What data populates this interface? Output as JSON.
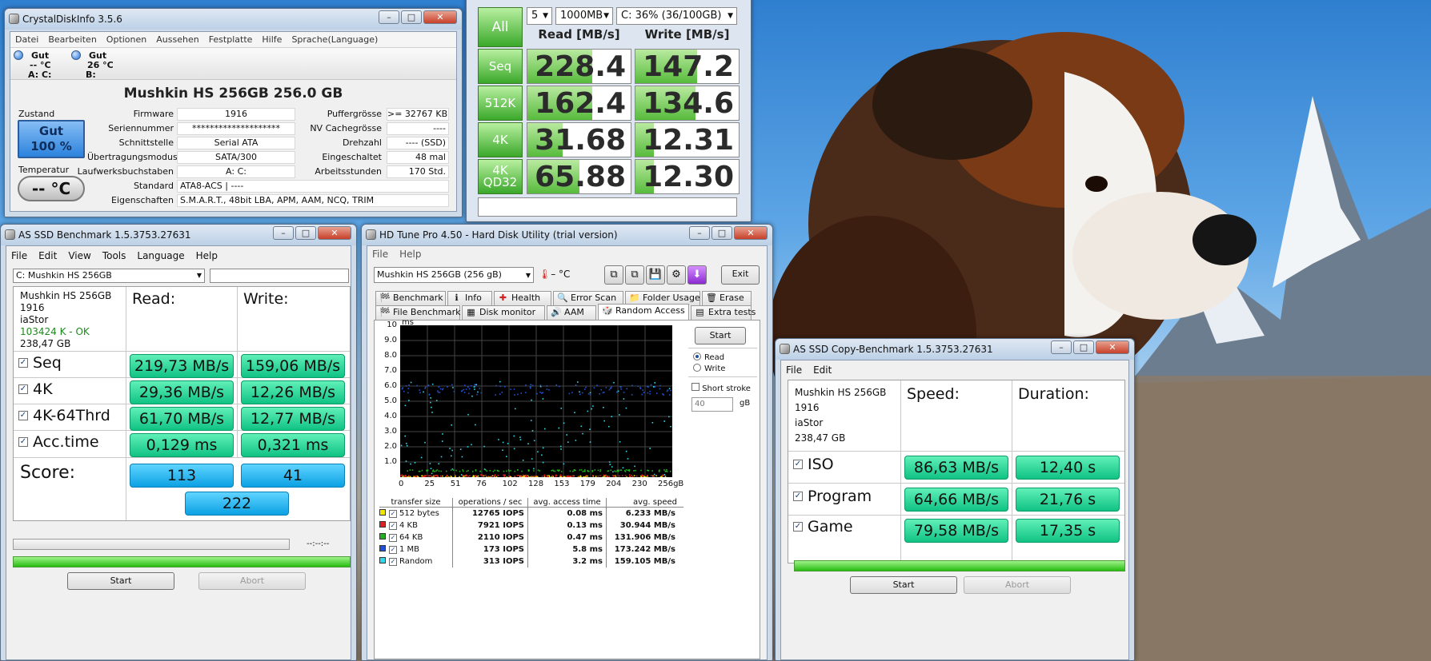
{
  "cdi": {
    "title": "CrystalDiskInfo 3.5.6",
    "menu": [
      "Datei",
      "Bearbeiten",
      "Optionen",
      "Aussehen",
      "Festplatte",
      "Hilfe",
      "Sprache(Language)"
    ],
    "drives": [
      {
        "status": "Gut",
        "temp": "-- °C",
        "letter": "A: C:"
      },
      {
        "status": "Gut",
        "temp": "26 °C",
        "letter": "B:"
      }
    ],
    "model": "Mushkin HS 256GB  256.0 GB",
    "zustand_label": "Zustand",
    "status_text": "Gut",
    "status_pct": "100 %",
    "temp_label": "Temperatur",
    "temp_value": "-- °C",
    "left_fields": [
      {
        "label": "Firmware",
        "value": "1916"
      },
      {
        "label": "Seriennummer",
        "value": "********************"
      },
      {
        "label": "Schnittstelle",
        "value": "Serial ATA"
      },
      {
        "label": "Übertragungsmodus",
        "value": "SATA/300"
      },
      {
        "label": "Laufwerksbuchstaben",
        "value": "A: C:"
      }
    ],
    "right_fields": [
      {
        "label": "Puffergrösse",
        "value": ">= 32767 KB"
      },
      {
        "label": "NV Cachegrösse",
        "value": "----"
      },
      {
        "label": "Drehzahl",
        "value": "---- (SSD)"
      },
      {
        "label": "Eingeschaltet",
        "value": "48 mal"
      },
      {
        "label": "Arbeitsstunden",
        "value": "170 Std."
      }
    ],
    "standard_label": "Standard",
    "standard_value": "ATA8-ACS | ----",
    "features_label": "Eigenschaften",
    "features_value": "S.M.A.R.T., 48bit LBA, APM, AAM, NCQ, TRIM"
  },
  "cdm": {
    "all_label": "All",
    "runs": "5",
    "size": "1000MB",
    "drive": "C: 36% (36/100GB)",
    "read_header": "Read [MB/s]",
    "write_header": "Write [MB/s]",
    "rows": [
      {
        "label": "Seq",
        "read": "228.4",
        "write": "147.2",
        "read_fill": 0.63,
        "write_fill": 0.6
      },
      {
        "label": "512K",
        "read": "162.4",
        "write": "134.6",
        "read_fill": 0.63,
        "write_fill": 0.58
      },
      {
        "label": "4K",
        "read": "31.68",
        "write": "12.31",
        "read_fill": 0.34,
        "write_fill": 0.18
      },
      {
        "label": "4K\nQD32",
        "read": "65.88",
        "write": "12.30",
        "read_fill": 0.5,
        "write_fill": 0.18
      }
    ]
  },
  "asb": {
    "title": "AS SSD Benchmark 1.5.3753.27631",
    "menu": [
      "File",
      "Edit",
      "View",
      "Tools",
      "Language",
      "Help"
    ],
    "drive_select": "C: Mushkin HS 256GB",
    "info": [
      "Mushkin HS 256GB",
      "1916",
      "iaStor",
      "103424 K - OK",
      "238,47 GB"
    ],
    "read_header": "Read:",
    "write_header": "Write:",
    "rows": [
      {
        "label": "Seq",
        "read": "219,73 MB/s",
        "write": "159,06 MB/s"
      },
      {
        "label": "4K",
        "read": "29,36 MB/s",
        "write": "12,26 MB/s"
      },
      {
        "label": "4K-64Thrd",
        "read": "61,70 MB/s",
        "write": "12,77 MB/s"
      },
      {
        "label": "Acc.time",
        "read": "0,129 ms",
        "write": "0,321 ms"
      }
    ],
    "score_label": "Score:",
    "score_read": "113",
    "score_write": "41",
    "score_total": "222",
    "time": "--:--:--",
    "start": "Start",
    "abort": "Abort"
  },
  "hdt": {
    "title": "HD Tune Pro 4.50 - Hard Disk Utility (trial version)",
    "menu": [
      "File",
      "Help"
    ],
    "drive": "Mushkin HS 256GB        (256 gB)",
    "temp": "– °C",
    "exit": "Exit",
    "tabs_row1": [
      {
        "label": "Benchmark",
        "icon": "🏁"
      },
      {
        "label": "Info",
        "icon": "ℹ"
      },
      {
        "label": "Health",
        "icon": "✚"
      },
      {
        "label": "Error Scan",
        "icon": "🔍"
      },
      {
        "label": "Folder Usage",
        "icon": "📁"
      },
      {
        "label": "Erase",
        "icon": "🗑"
      }
    ],
    "tabs_row2": [
      {
        "label": "File Benchmark",
        "icon": "🏁"
      },
      {
        "label": "Disk monitor",
        "icon": "▦"
      },
      {
        "label": "AAM",
        "icon": "🔊"
      },
      {
        "label": "Random Access",
        "icon": "🎲"
      },
      {
        "label": "Extra tests",
        "icon": "▤"
      }
    ],
    "start": "Start",
    "read": "Read",
    "write": "Write",
    "short_stroke": "Short stroke",
    "gb_value": "40",
    "gb_unit": "gB",
    "y_unit": "ms",
    "y_ticks": [
      "10",
      "9.0",
      "8.0",
      "7.0",
      "6.0",
      "5.0",
      "4.0",
      "3.0",
      "2.0",
      "1.0"
    ],
    "x_ticks": [
      "0",
      "25",
      "51",
      "76",
      "102",
      "128",
      "153",
      "179",
      "204",
      "230",
      "256gB"
    ],
    "table_headers": [
      "transfer size",
      "operations / sec",
      "avg. access time",
      "avg. speed"
    ],
    "results": [
      {
        "size": "512 bytes",
        "ops": "12765 IOPS",
        "time": "0.08 ms",
        "speed": "6.233 MB/s",
        "color": "#f2e600"
      },
      {
        "size": "4 KB",
        "ops": "7921 IOPS",
        "time": "0.13 ms",
        "speed": "30.944 MB/s",
        "color": "#e02020"
      },
      {
        "size": "64 KB",
        "ops": "2110 IOPS",
        "time": "0.47 ms",
        "speed": "131.906 MB/s",
        "color": "#20b020"
      },
      {
        "size": "1 MB",
        "ops": "173 IOPS",
        "time": "5.8 ms",
        "speed": "173.242 MB/s",
        "color": "#2050d8"
      },
      {
        "size": "Random",
        "ops": "313 IOPS",
        "time": "3.2 ms",
        "speed": "159.105 MB/s",
        "color": "#30d8e8"
      }
    ]
  },
  "asc": {
    "title": "AS SSD Copy-Benchmark 1.5.3753.27631",
    "menu": [
      "File",
      "Edit"
    ],
    "info": [
      "Mushkin HS 256GB",
      "1916",
      "iaStor",
      "238,47 GB"
    ],
    "speed_header": "Speed:",
    "duration_header": "Duration:",
    "rows": [
      {
        "label": "ISO",
        "speed": "86,63 MB/s",
        "duration": "12,40 s"
      },
      {
        "label": "Program",
        "speed": "64,66 MB/s",
        "duration": "21,76 s"
      },
      {
        "label": "Game",
        "speed": "79,58 MB/s",
        "duration": "17,35 s"
      }
    ],
    "start": "Start",
    "abort": "Abort"
  }
}
